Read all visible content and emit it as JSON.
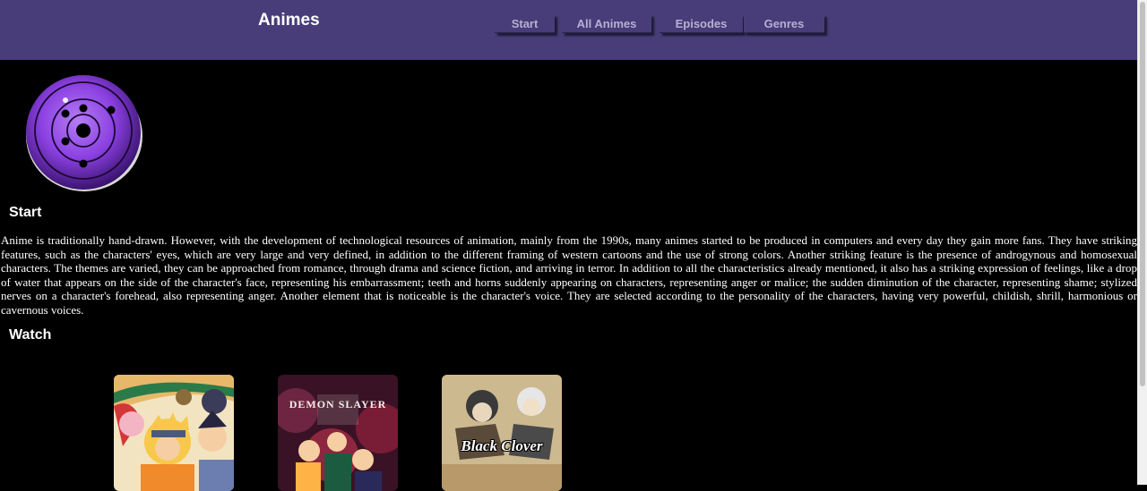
{
  "header": {
    "brand": "Animes",
    "nav": [
      "Start",
      "All Animes",
      "Episodes",
      "Genres"
    ],
    "background": "#483d78"
  },
  "logo": {
    "icon": "rinnegan-eye-icon",
    "accent": "#8a3fe0"
  },
  "start": {
    "title": "Start",
    "body": "Anime is traditionally hand-drawn. However, with the development of technological resources of animation, mainly from the 1990s, many animes started to be produced in computers and every day they gain more fans. They have striking features, such as the characters' eyes, which are very large and very defined, in addition to the different framing of western cartoons and the use of strong colors. Another striking feature is the presence of androgynous and homosexual characters. The themes are varied, they can be approached from romance, through drama and science fiction, and arriving in terror. In addition to all the characteristics already mentioned, it also has a striking expression of feelings, like a drop of water that appears on the side of the character's face, representing his embarrassment; teeth and horns suddenly appearing on characters, representing anger or malice; the sudden diminution of the character, representing shame; stylized nerves on a character's forehead, also representing anger. Another element that is noticeable is the character's voice. They are selected according to the personality of the characters, having very powerful, childish, shrill, harmonious or cavernous voices."
  },
  "watch": {
    "title": "Watch",
    "posters": [
      {
        "icon": "naruto-poster-image"
      },
      {
        "icon": "demon-slayer-poster-image",
        "logo_text": "DEMON SLAYER"
      },
      {
        "icon": "black-clover-poster-image",
        "logo_text": "Black Clover"
      }
    ]
  }
}
